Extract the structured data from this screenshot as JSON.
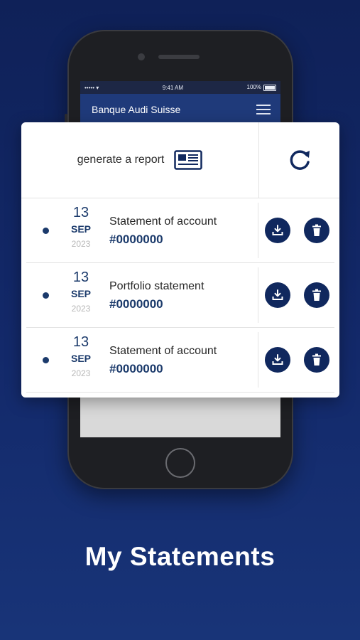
{
  "statusbar": {
    "signal": "••••• ▾",
    "time": "9:41 AM",
    "battery": "100%"
  },
  "app": {
    "title": "Banque Audi Suisse"
  },
  "report": {
    "label": "generate a report"
  },
  "statements": [
    {
      "day": "13",
      "month": "SEP",
      "year": "2023",
      "title": "Statement of account",
      "number": "#0000000"
    },
    {
      "day": "13",
      "month": "SEP",
      "year": "2023",
      "title": "Portfolio statement",
      "number": "#0000000"
    },
    {
      "day": "13",
      "month": "SEP",
      "year": "2023",
      "title": "Statement of account",
      "number": "#0000000"
    }
  ],
  "caption": "My Statements",
  "colors": {
    "background": "#13296a",
    "primary": "#10285e",
    "navbar": "#1f3a7a",
    "muted": "#b7b7b7"
  }
}
